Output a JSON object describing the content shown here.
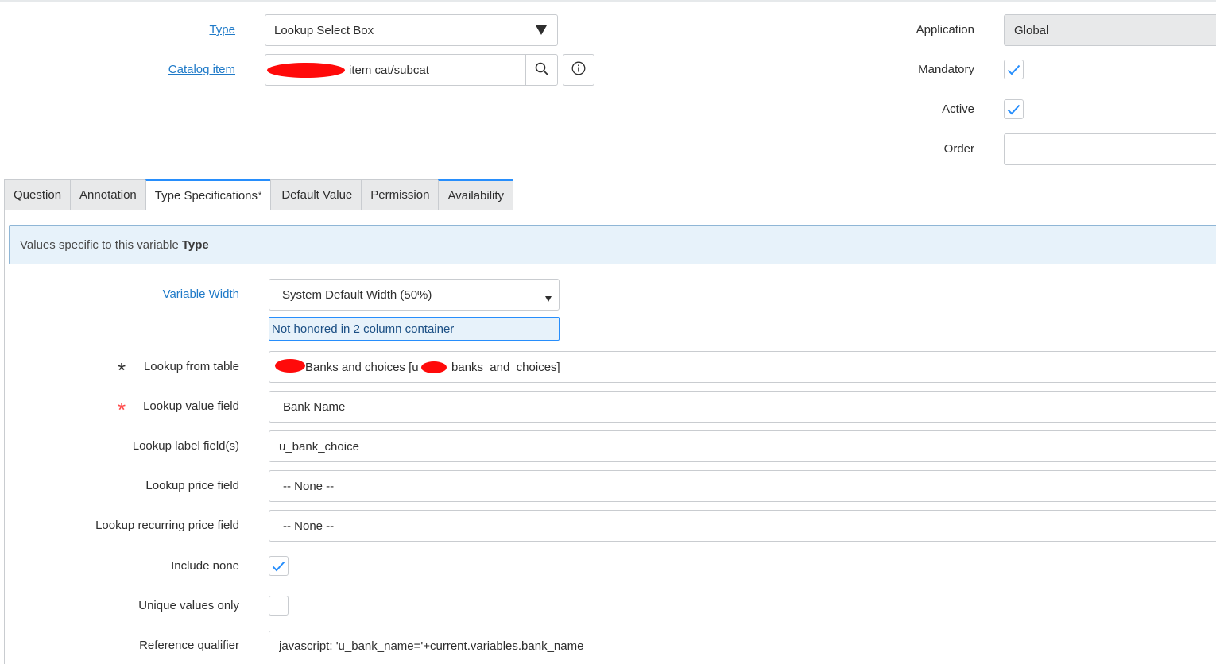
{
  "header": {
    "type_label": "Type",
    "type_value": "Lookup Select Box",
    "catalog_label": "Catalog item",
    "catalog_value": "item cat/subcat",
    "application_label": "Application",
    "application_value": "Global",
    "mandatory_label": "Mandatory",
    "mandatory_checked": true,
    "active_label": "Active",
    "active_checked": true,
    "order_label": "Order",
    "order_value": ""
  },
  "tabs": [
    {
      "label": "Question"
    },
    {
      "label": "Annotation"
    },
    {
      "label": "Type Specifications",
      "active": true,
      "modified_marker": "*"
    },
    {
      "label": "Default Value"
    },
    {
      "label": "Permission"
    },
    {
      "label": "Availability"
    }
  ],
  "info_banner": {
    "text": "Values specific to this variable",
    "bold": "Type"
  },
  "form": {
    "variable_width_label": "Variable Width",
    "variable_width_value": "System Default Width (50%)",
    "variable_width_hint": "Not honored in 2 column container",
    "lookup_table_label": "Lookup from table",
    "lookup_table_value_a": "Banks and choices [u_",
    "lookup_table_value_b": "banks_and_choices]",
    "lookup_value_label": "Lookup value field",
    "lookup_value_value": "Bank Name",
    "lookup_label_label": "Lookup label field(s)",
    "lookup_label_value": "u_bank_choice",
    "price_label": "Lookup price field",
    "price_value": "-- None --",
    "recurring_label": "Lookup recurring price field",
    "recurring_value": "-- None --",
    "include_none_label": "Include none",
    "include_none_checked": true,
    "unique_label": "Unique values only",
    "unique_checked": false,
    "ref_qual_label": "Reference qualifier",
    "ref_qual_value": "javascript: 'u_bank_name='+current.variables.bank_name"
  },
  "icons": {
    "search": "search-icon",
    "info": "info-icon",
    "dropdown": "caret-down-icon",
    "check": "check-icon",
    "required": "asterisk-icon"
  },
  "colors": {
    "link": "#1f7ac8",
    "accent": "#278efc",
    "required_filled": "#2e2e2e",
    "required_empty": "#ff4a4a",
    "redaction": "#ff0a0a"
  }
}
